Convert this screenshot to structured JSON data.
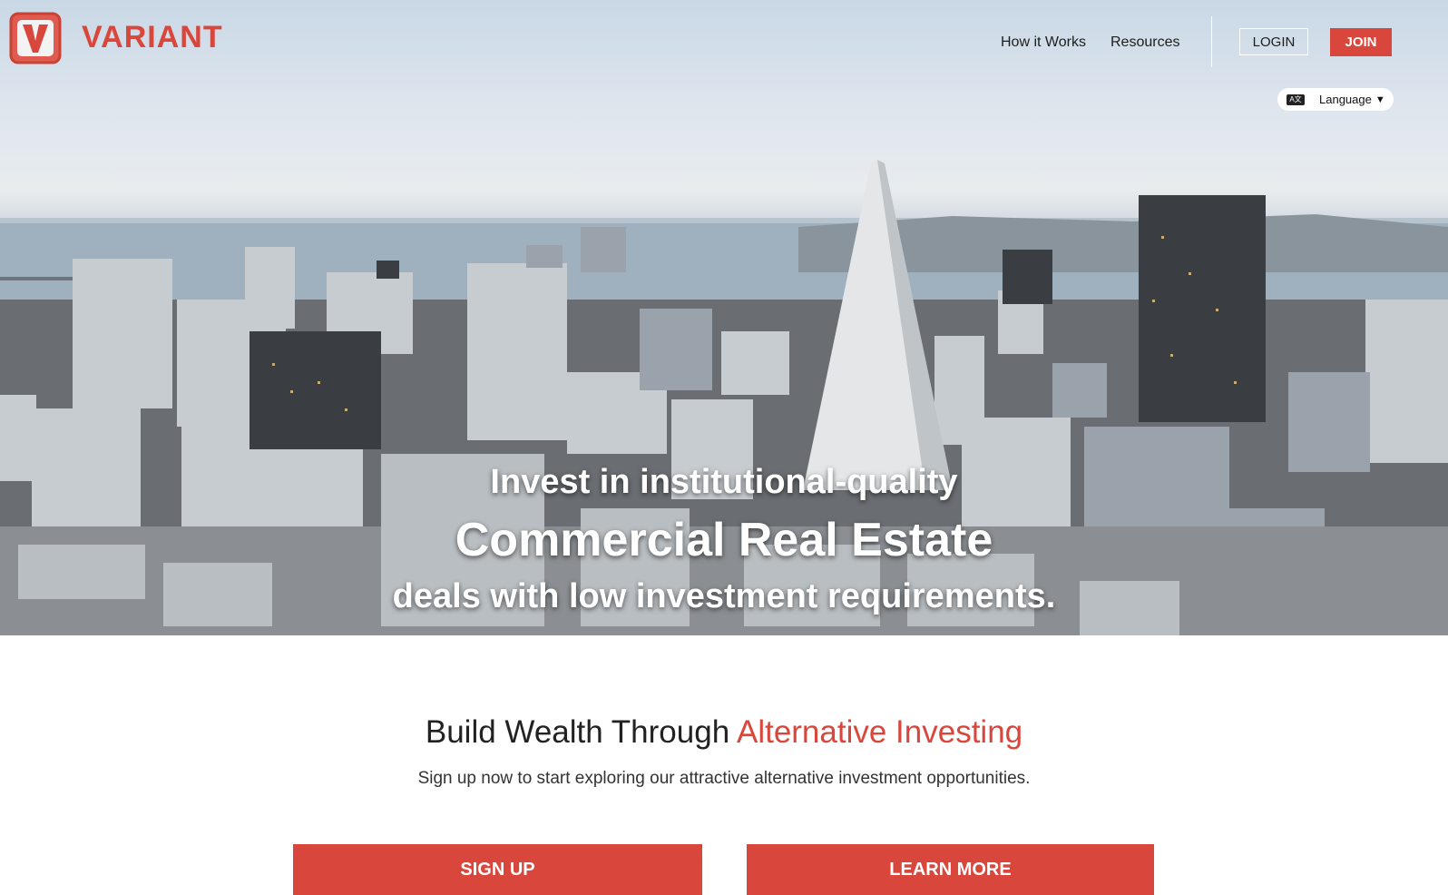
{
  "brand": {
    "name": "VARIANT",
    "logo_letter": "V",
    "color": "#d9473c"
  },
  "nav": {
    "links": [
      "How it Works",
      "Resources"
    ],
    "login_label": "LOGIN",
    "join_label": "JOIN",
    "language_label": "Language",
    "language_icon": "translate-icon"
  },
  "hero": {
    "line1": "Invest in institutional-quality",
    "line2": "Commercial Real Estate",
    "line3": "deals with low investment requirements."
  },
  "section": {
    "title_prefix": "Build Wealth Through ",
    "title_accent": "Alternative Investing",
    "subtitle": "Sign up now to start exploring our attractive alternative investment opportunities."
  },
  "cta": {
    "signup_label": "SIGN UP",
    "learn_more_label": "LEARN MORE"
  }
}
